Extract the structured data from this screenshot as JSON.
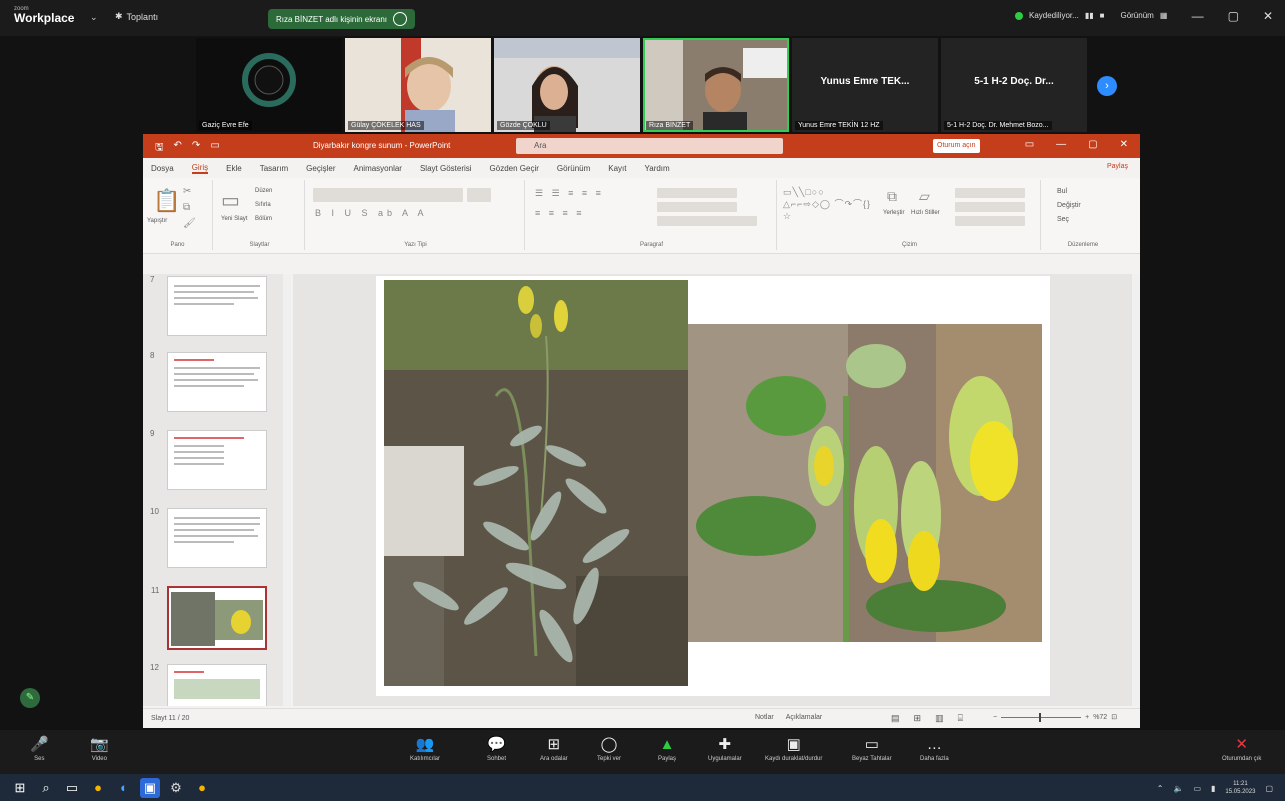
{
  "zoom": {
    "app_small": "zoom",
    "app_name": "Workplace",
    "meeting_label": "Toplantı",
    "share_banner": "Rıza BİNZET adlı kişinin ekranı",
    "recording": "Kaydediliyor...",
    "view_label": "Görünüm",
    "participants": [
      {
        "name": "Gaziç Evre Efe"
      },
      {
        "name": "Gülay ÇÖKELEK HAS"
      },
      {
        "name": "Gözde ÇOKLU"
      },
      {
        "name": "Rıza BİNZET"
      },
      {
        "name": "Yunus Emre TEK...",
        "label": "Yunus Emre TEKİN 12 HZ"
      },
      {
        "name": "5-1 H-2 Doç. Dr...",
        "label": "5-1 H-2 Doç. Dr. Mehmet Bozo..."
      }
    ],
    "bottom": [
      {
        "icon": "🎤",
        "label": "Ses"
      },
      {
        "icon": "📷",
        "label": "Video"
      },
      {
        "icon": "👥",
        "label": "Katılımcılar"
      },
      {
        "icon": "💬",
        "label": "Sohbet"
      },
      {
        "icon": "⊞",
        "label": "Ara odalar"
      },
      {
        "icon": "◯",
        "label": "Tepki ver"
      },
      {
        "icon": "▲",
        "label": "Paylaş"
      },
      {
        "icon": "✚",
        "label": "Uygulamalar"
      },
      {
        "icon": "▣",
        "label": "Kaydı duraklat/durdur"
      },
      {
        "icon": "▭",
        "label": "Beyaz Tahtalar"
      },
      {
        "icon": "…",
        "label": "Daha fazla"
      },
      {
        "icon": "✕",
        "label": "Oturumdan çık"
      }
    ]
  },
  "ppt": {
    "doc_title": "Diyarbakır kongre sunum - PowerPoint",
    "search_placeholder": "Ara",
    "signin": "Oturum açın",
    "share": "Paylaş",
    "tabs": [
      "Dosya",
      "Giriş",
      "Ekle",
      "Tasarım",
      "Geçişler",
      "Animasyonlar",
      "Slayt Gösterisi",
      "Gözden Geçir",
      "Görünüm",
      "Kayıt",
      "Yardım"
    ],
    "groups": [
      "Pano",
      "Slaytlar",
      "Yazı Tipi",
      "Paragraf",
      "Çizim",
      "Düzenleme"
    ],
    "ribbon_labels": {
      "paste": "Yapıştır",
      "new_slide": "Yeni Slayt",
      "layout": "Düzen",
      "reset": "Sıfırla",
      "section": "Bölüm",
      "arrange": "Yerleştir",
      "quick_styles": "Hızlı Stiller",
      "find": "Bul",
      "replace": "Değiştir",
      "select": "Seç"
    },
    "slide_numbers": [
      "7",
      "8",
      "9",
      "10",
      "11",
      "12"
    ],
    "status_left": "Slayt 11 / 20",
    "notes": "Notlar",
    "comments": "Açıklamalar",
    "zoom_pct": "%72"
  },
  "taskbar": {
    "time": "11:21",
    "date": "15.05.2023"
  }
}
